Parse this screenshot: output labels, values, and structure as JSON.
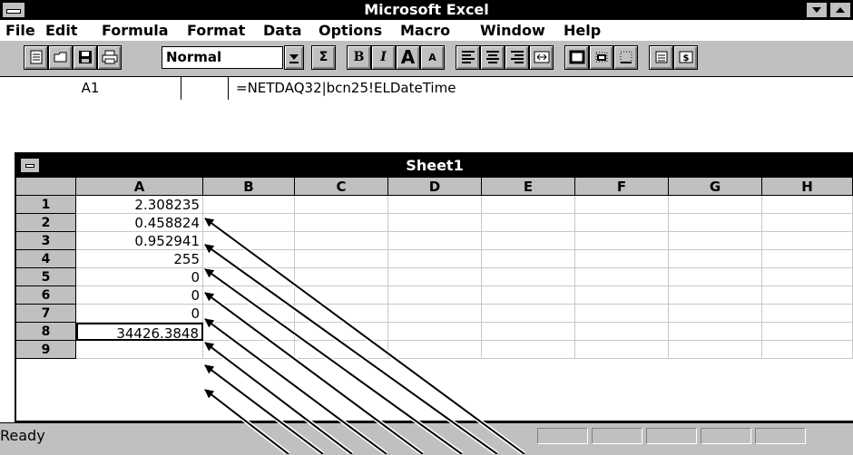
{
  "window": {
    "title": "Microsoft Excel"
  },
  "menu": [
    "File",
    "Edit",
    "Formula",
    "Format",
    "Data",
    "Options",
    "Macro",
    "Window",
    "Help"
  ],
  "toolbar": {
    "style_value": "Normal",
    "icons": [
      "new-sheet-icon",
      "open-icon",
      "save-icon",
      "print-icon",
      "style-dropdown-icon",
      "autosum-icon",
      "bold-icon",
      "italic-icon",
      "increase-font-icon",
      "decrease-font-icon",
      "align-left-icon",
      "align-center-icon",
      "align-right-icon",
      "center-across-icon",
      "outline-border-icon",
      "bottom-border-icon",
      "dotted-border-icon",
      "select-visible-icon",
      "currency-icon"
    ],
    "autosum_glyph": "Σ",
    "bold_glyph": "B",
    "italic_glyph": "I",
    "bigA_glyph": "A",
    "smallA_glyph": "A"
  },
  "formula_bar": {
    "cell_ref": "A1",
    "formula": "=NETDAQ32|bcn25!ELDateTime"
  },
  "sheet": {
    "title": "Sheet1",
    "columns": [
      "A",
      "B",
      "C",
      "D",
      "E",
      "F",
      "G",
      "H"
    ],
    "rows": [
      "1",
      "2",
      "3",
      "4",
      "5",
      "6",
      "7",
      "8",
      "9"
    ],
    "col_a_values": [
      "2.308235",
      "0.458824",
      "0.952941",
      "255",
      "0",
      "0",
      "0",
      "34426.3848",
      ""
    ],
    "selected_cell": "A8"
  },
  "status": {
    "text": "Ready"
  }
}
